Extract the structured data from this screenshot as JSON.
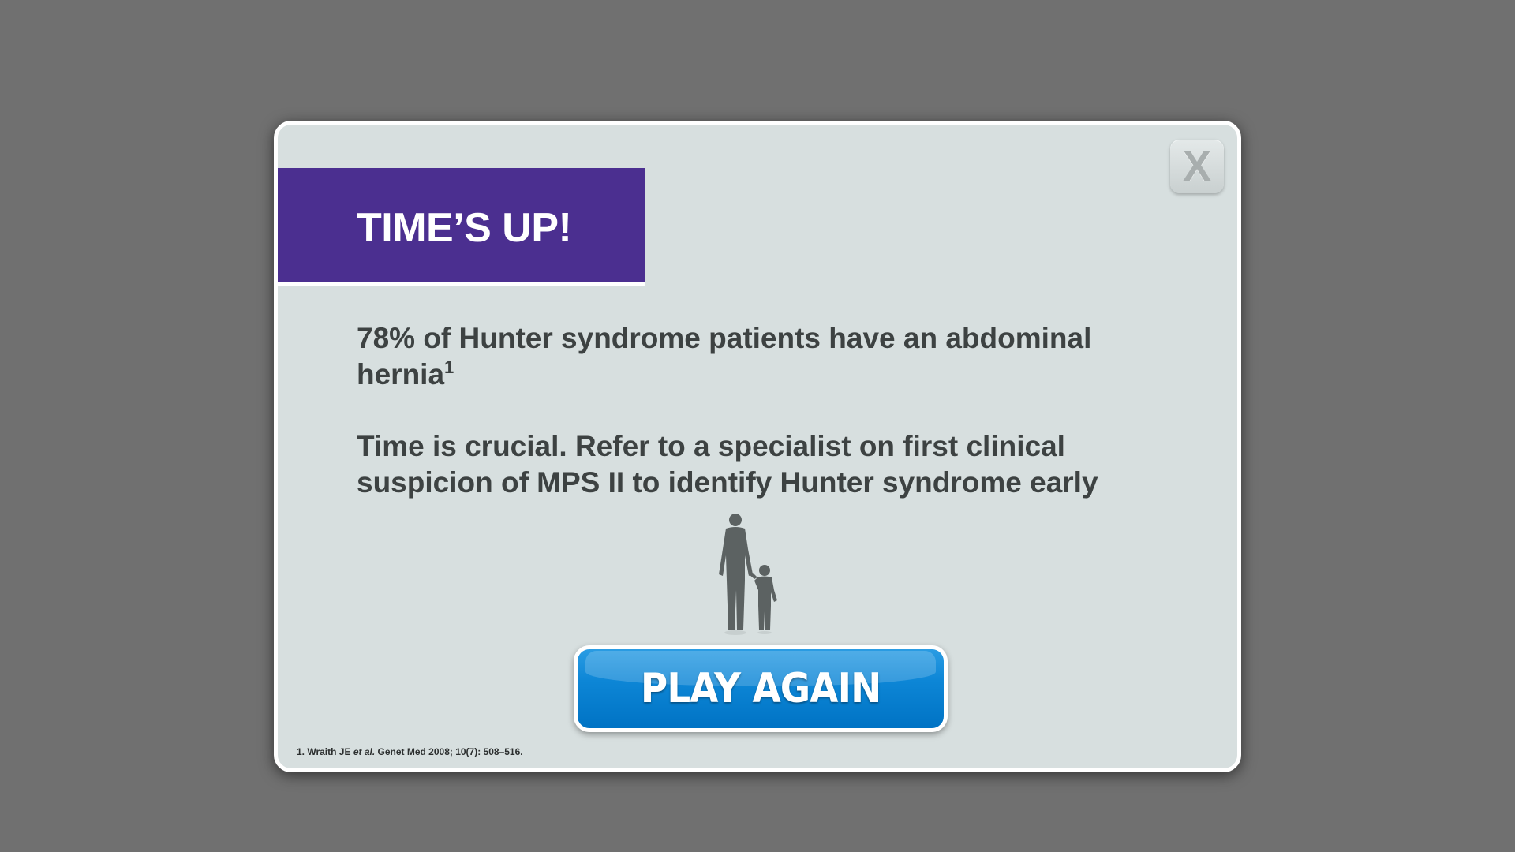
{
  "dialog": {
    "close_label": "X",
    "title": "TIME’S UP!",
    "fact_text": "78% of Hunter syndrome patients have an abdominal hernia",
    "fact_superscript": "1",
    "message": "Time is crucial. Refer to a specialist on first clinical suspicion of MPS II to identify Hunter syndrome early",
    "illustration_icon": "parent-and-child-silhouette-icon",
    "play_again_label": "PLAY AGAIN",
    "footnote": {
      "prefix": "1. Wraith JE ",
      "italic": "et al.",
      "suffix": " Genet Med 2008; 10(7): 508–516."
    }
  },
  "colors": {
    "background": "#707070",
    "dialog_bg": "#d7dfdf",
    "title_banner": "#4b2f90",
    "text": "#3d4242",
    "button_blue": "#0d86d6"
  }
}
